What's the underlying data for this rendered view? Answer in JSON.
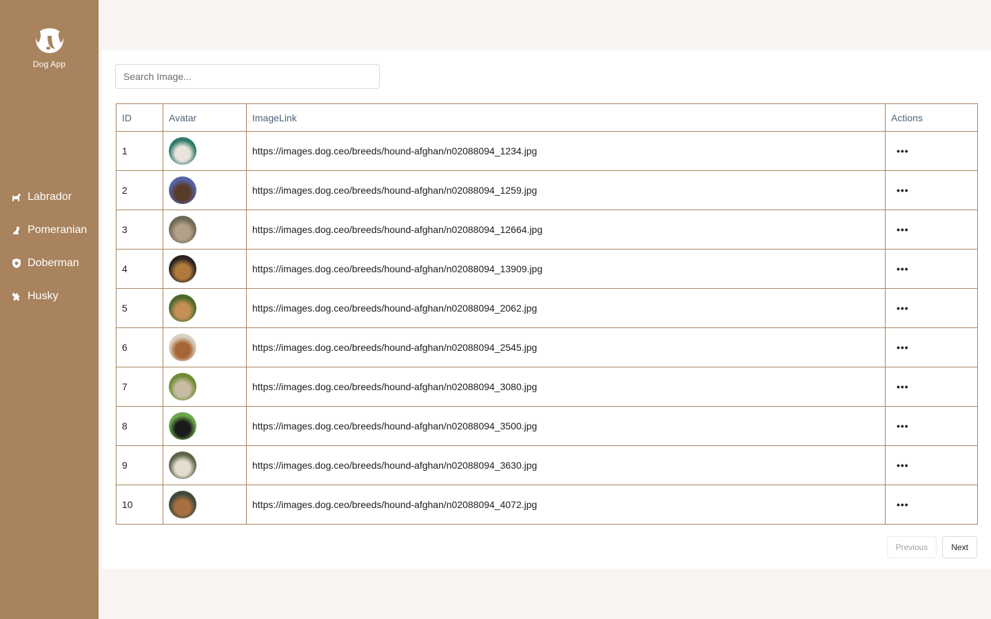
{
  "app": {
    "name": "Dog App"
  },
  "nav": [
    {
      "label": "Labrador",
      "icon": "dog-icon"
    },
    {
      "label": "Pomeranian",
      "icon": "cat-sitting-icon"
    },
    {
      "label": "Doberman",
      "icon": "shield-dog-icon"
    },
    {
      "label": "Husky",
      "icon": "wolf-icon"
    }
  ],
  "search": {
    "placeholder": "Search Image..."
  },
  "table": {
    "headers": {
      "id": "ID",
      "avatar": "Avatar",
      "image_link": "ImageLink",
      "actions": "Actions"
    },
    "rows": [
      {
        "id": "1",
        "link": "https://images.dog.ceo/breeds/hound-afghan/n02088094_1234.jpg",
        "avatar_colors": [
          "#2f7a6a",
          "#e8e4dc"
        ],
        "action": "•••"
      },
      {
        "id": "2",
        "link": "https://images.dog.ceo/breeds/hound-afghan/n02088094_1259.jpg",
        "avatar_colors": [
          "#5564a8",
          "#5a3a28"
        ],
        "action": "•••"
      },
      {
        "id": "3",
        "link": "https://images.dog.ceo/breeds/hound-afghan/n02088094_12664.jpg",
        "avatar_colors": [
          "#6e6a55",
          "#b5a088"
        ],
        "action": "•••"
      },
      {
        "id": "4",
        "link": "https://images.dog.ceo/breeds/hound-afghan/n02088094_13909.jpg",
        "avatar_colors": [
          "#2a2320",
          "#b07a3c"
        ],
        "action": "•••"
      },
      {
        "id": "5",
        "link": "https://images.dog.ceo/breeds/hound-afghan/n02088094_2062.jpg",
        "avatar_colors": [
          "#4e6a2c",
          "#c49054"
        ],
        "action": "•••"
      },
      {
        "id": "6",
        "link": "https://images.dog.ceo/breeds/hound-afghan/n02088094_2545.jpg",
        "avatar_colors": [
          "#d8d0c2",
          "#a86434"
        ],
        "action": "•••"
      },
      {
        "id": "7",
        "link": "https://images.dog.ceo/breeds/hound-afghan/n02088094_3080.jpg",
        "avatar_colors": [
          "#6f8c34",
          "#c8bca4"
        ],
        "action": "•••"
      },
      {
        "id": "8",
        "link": "https://images.dog.ceo/breeds/hound-afghan/n02088094_3500.jpg",
        "avatar_colors": [
          "#6aa84c",
          "#1a1a1a"
        ],
        "action": "•••"
      },
      {
        "id": "9",
        "link": "https://images.dog.ceo/breeds/hound-afghan/n02088094_3630.jpg",
        "avatar_colors": [
          "#5d6448",
          "#e4ddd0"
        ],
        "action": "•••"
      },
      {
        "id": "10",
        "link": "https://images.dog.ceo/breeds/hound-afghan/n02088094_4072.jpg",
        "avatar_colors": [
          "#3e4a3a",
          "#a87040"
        ],
        "action": "•••"
      }
    ]
  },
  "pagination": {
    "previous": "Previous",
    "next": "Next"
  },
  "colors": {
    "sidebar": "#a8835d",
    "background": "#f7f4f1",
    "border": "#a8835d"
  }
}
